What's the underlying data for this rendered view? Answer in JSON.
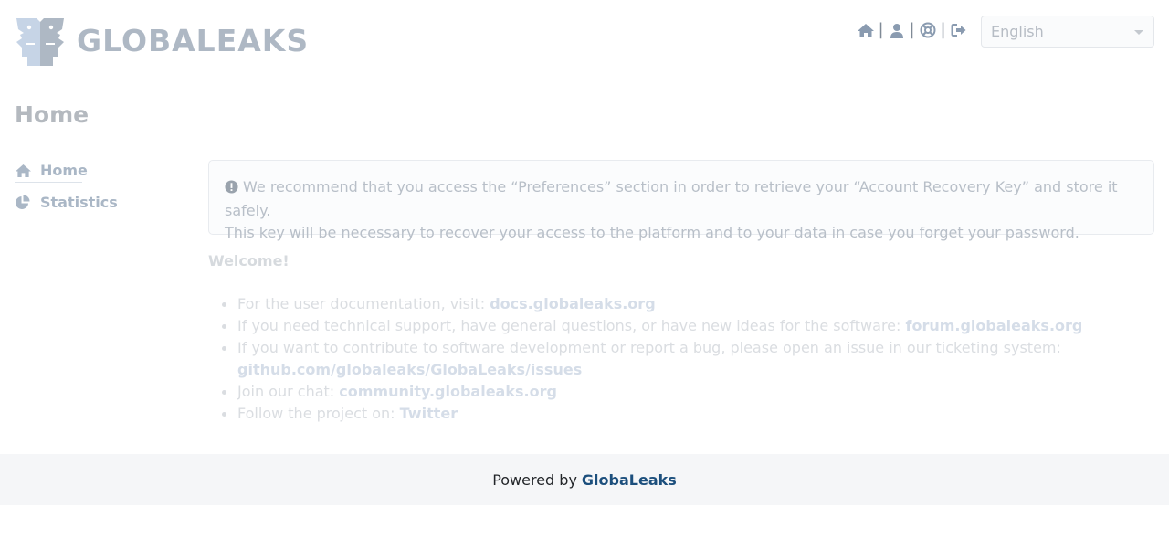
{
  "app": {
    "logo_text": "GLOBALEAKS",
    "logo_icon": "two-faces-logo",
    "colors": {
      "logo": "#aeb8c4",
      "logo_accent": "#c6d4e6",
      "footer_link": "#1c4f7d"
    }
  },
  "topnav": {
    "items": [
      {
        "icon": "home-icon"
      },
      {
        "icon": "user-icon"
      },
      {
        "icon": "lifebuoy-icon"
      },
      {
        "icon": "logout-icon"
      }
    ],
    "separator": "|"
  },
  "language": {
    "selected": "English"
  },
  "page": {
    "title": "Home"
  },
  "sidebar": {
    "items": [
      {
        "label": "Home",
        "icon": "home-icon",
        "active": true
      },
      {
        "label": "Statistics",
        "icon": "pie-chart-icon",
        "active": false
      }
    ]
  },
  "alert": {
    "icon": "exclamation-circle-icon",
    "line1": "We recommend that you access the “Preferences” section in order to retrieve your “Account Recovery Key” and store it safely.",
    "line2": "This key will be necessary to recover your access to the platform and to your data in case you forget your password."
  },
  "welcome": {
    "heading": "Welcome!",
    "items": [
      {
        "text": "For the user documentation, visit: ",
        "link": "docs.globaleaks.org"
      },
      {
        "text": "If you need technical support, have general questions, or have new ideas for the software: ",
        "link": "forum.globaleaks.org"
      },
      {
        "text": "If you want to contribute to software development or report a bug, please open an issue in our ticketing system: ",
        "link": "github.com/globaleaks/GlobaLeaks/issues"
      },
      {
        "text": "Join our chat: ",
        "link": "community.globaleaks.org"
      },
      {
        "text": "Follow the project on: ",
        "link": "Twitter"
      }
    ]
  },
  "footer": {
    "prefix": "Powered by",
    "link": "GlobaLeaks"
  }
}
